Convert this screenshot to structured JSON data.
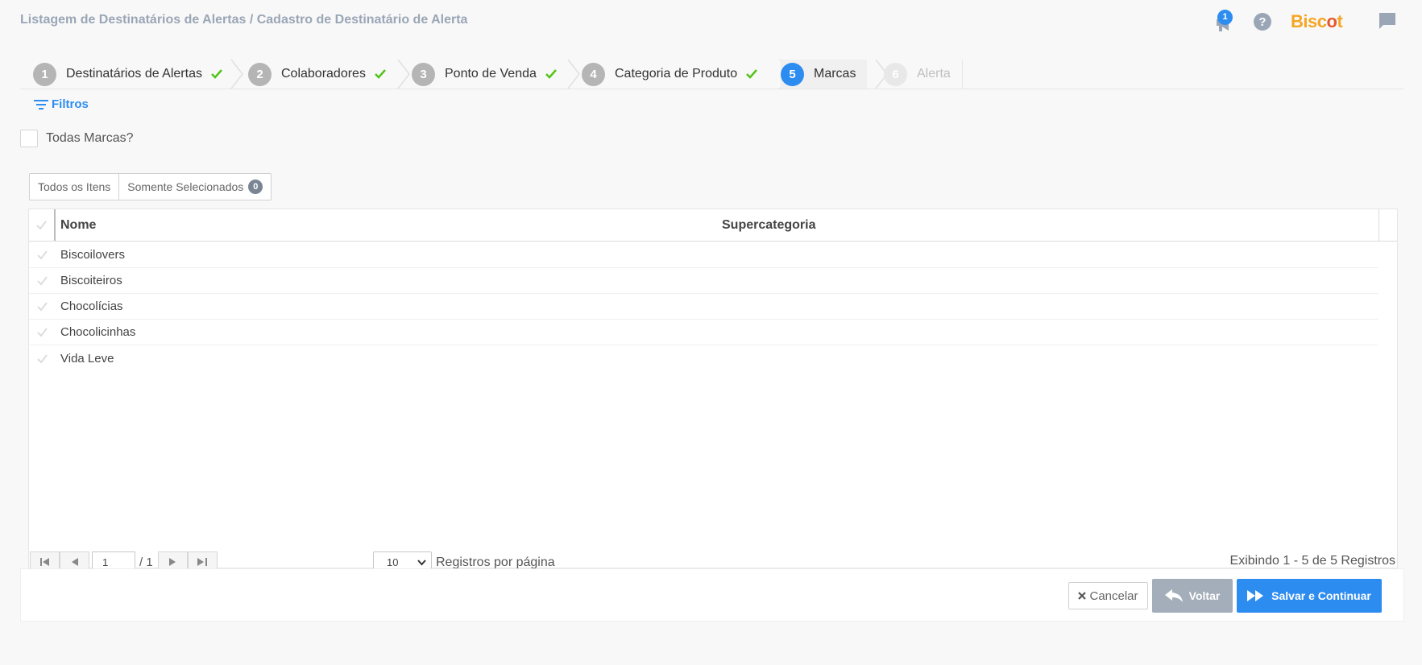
{
  "header": {
    "breadcrumb": "Listagem de Destinatários de Alertas / Cadastro de Destinatário de Alerta",
    "notification_count": "1",
    "brand_text": "Bisc",
    "brand_accent": "o",
    "brand_tail": "t",
    "icons": [
      "megaphone-icon",
      "help-icon",
      "chat-icon"
    ]
  },
  "wizard": {
    "steps": [
      {
        "num": "1",
        "label": "Destinatários de Alertas",
        "state": "done"
      },
      {
        "num": "2",
        "label": "Colaboradores",
        "state": "done"
      },
      {
        "num": "3",
        "label": "Ponto de Venda",
        "state": "done"
      },
      {
        "num": "4",
        "label": "Categoria de Produto",
        "state": "done"
      },
      {
        "num": "5",
        "label": "Marcas",
        "state": "active"
      },
      {
        "num": "6",
        "label": "Alerta",
        "state": "disabled"
      }
    ]
  },
  "filters_label": "Filtros",
  "all_brands_label": "Todas Marcas?",
  "toggle": {
    "all_items": "Todos os Itens",
    "only_selected": "Somente Selecionados",
    "selected_count": "0"
  },
  "table": {
    "columns": [
      "Nome",
      "Supercategoria"
    ],
    "rows": [
      {
        "name": "Biscoilovers",
        "supercategory": ""
      },
      {
        "name": "Biscoiteiros",
        "supercategory": ""
      },
      {
        "name": "Chocolícias",
        "supercategory": ""
      },
      {
        "name": "Chocolicinhas",
        "supercategory": ""
      },
      {
        "name": "Vida Leve",
        "supercategory": ""
      }
    ]
  },
  "pager": {
    "current_page": "1",
    "total_label": "/ 1",
    "per_page": "10",
    "per_page_label": "Registros por página",
    "showing": "Exibindo 1 - 5 de 5 Registros"
  },
  "footer": {
    "cancel": "Cancelar",
    "back": "Voltar",
    "save": "Salvar e Continuar"
  },
  "colors": {
    "primary": "#2d8cf0",
    "success": "#52c41a",
    "muted_button": "#a4adba",
    "brand": "#f5a623"
  }
}
